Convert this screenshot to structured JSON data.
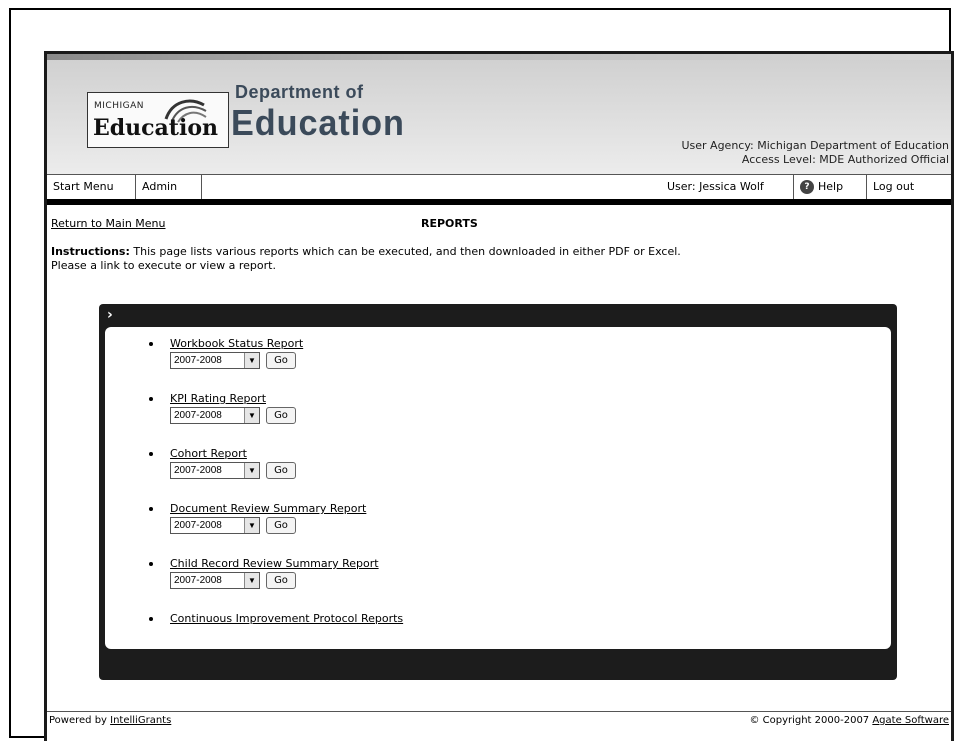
{
  "header": {
    "logo_small": "MICHIGAN",
    "logo_big": "Education",
    "dept_small": "Department of",
    "dept_big": "Education",
    "agency_line": "User Agency: Michigan Department of Education",
    "access_line": "Access Level: MDE Authorized Official"
  },
  "nav": {
    "start_menu": "Start Menu",
    "admin": "Admin",
    "user": "User: Jessica Wolf",
    "help": "Help",
    "logout": "Log out"
  },
  "page": {
    "return_link": "Return to Main Menu",
    "title": "REPORTS",
    "instructions_label": "Instructions:",
    "instructions_text": " This page lists various reports which can be executed, and then downloaded in either PDF or Excel.",
    "instructions_line2": "Please a link to execute or view a report."
  },
  "reports": [
    {
      "name": "Workbook Status Report",
      "year": "2007-2008",
      "go": "Go"
    },
    {
      "name": "KPI Rating Report",
      "year": "2007-2008",
      "go": "Go"
    },
    {
      "name": "Cohort Report",
      "year": "2007-2008",
      "go": "Go"
    },
    {
      "name": "Document Review Summary Report",
      "year": "2007-2008",
      "go": "Go"
    },
    {
      "name": "Child Record Review Summary Report",
      "year": "2007-2008",
      "go": "Go"
    }
  ],
  "continuous_link": "Continuous Improvement Protocol Reports",
  "footer": {
    "powered_prefix": "Powered by ",
    "powered_link": "IntelliGrants",
    "copyright_prefix": "© Copyright 2000-2007 ",
    "copyright_link": "Agate Software"
  }
}
